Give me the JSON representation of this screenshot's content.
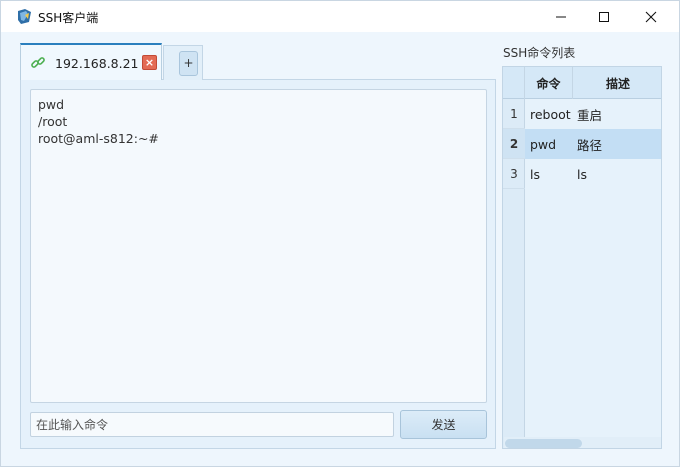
{
  "window": {
    "title": "SSH客户端",
    "app_icon": "ssh-app-icon"
  },
  "controls": {
    "minimize_icon": "minimize-icon",
    "maximize_icon": "maximize-icon",
    "close_icon": "close-icon"
  },
  "tabs": {
    "active": {
      "label": "192.168.8.21",
      "icon": "link-icon",
      "close_symbol": "×"
    },
    "add_label": "+"
  },
  "terminal": {
    "lines": [
      "pwd",
      "/root",
      "root@aml-s812:~#"
    ]
  },
  "command": {
    "placeholder": "在此输入命令",
    "value": "",
    "send_label": "发送"
  },
  "side": {
    "title": "SSH命令列表",
    "columns": [
      "命令",
      "描述"
    ],
    "rows": [
      {
        "num": "1",
        "cmd": "reboot",
        "desc": "重启",
        "selected": false
      },
      {
        "num": "2",
        "cmd": "pwd",
        "desc": "路径",
        "selected": true
      },
      {
        "num": "3",
        "cmd": "ls",
        "desc": "ls",
        "selected": false
      }
    ]
  },
  "colors": {
    "accent": "#2a7fbe",
    "close_badge": "#e36b55",
    "selection": "#c3def4",
    "link_icon": "#4caf50"
  }
}
